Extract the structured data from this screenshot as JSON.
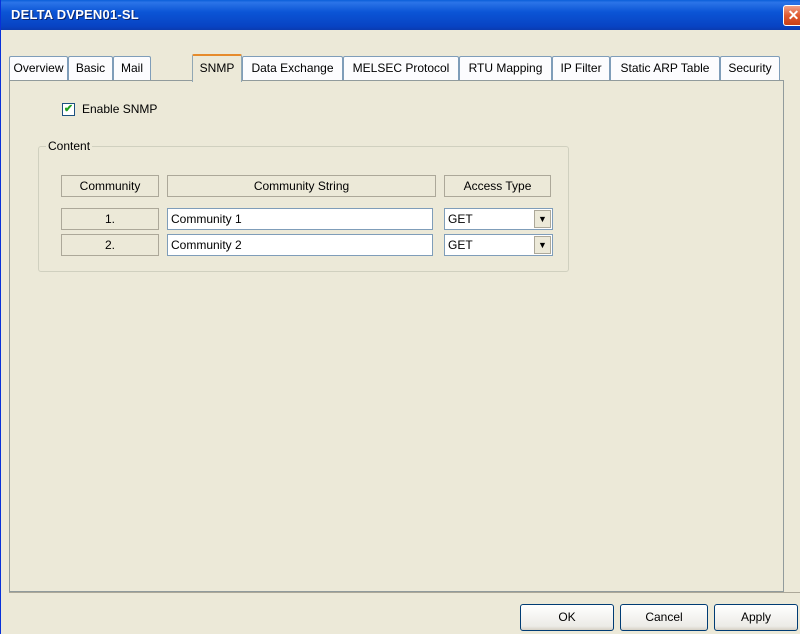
{
  "window": {
    "title": "DELTA DVPEN01-SL",
    "close_symbol": "✕"
  },
  "tabs": [
    {
      "label": "Overview"
    },
    {
      "label": "Basic"
    },
    {
      "label": "Mail"
    },
    {
      "label": "SNMP"
    },
    {
      "label": "Data Exchange"
    },
    {
      "label": "MELSEC Protocol"
    },
    {
      "label": "RTU Mapping"
    },
    {
      "label": "IP Filter"
    },
    {
      "label": "Static ARP Table"
    },
    {
      "label": "Security"
    }
  ],
  "active_tab": "SNMP",
  "snmp": {
    "enable_label": "Enable SNMP",
    "enable_checked": true,
    "check_mark": "✔",
    "content_group_label": "Content",
    "columns": {
      "community": "Community",
      "string": "Community String",
      "access": "Access Type"
    },
    "rows": [
      {
        "num": "1.",
        "string": "Community 1",
        "access": "GET"
      },
      {
        "num": "2.",
        "string": "Community 2",
        "access": "GET"
      }
    ],
    "dropdown_arrow": "▼"
  },
  "buttons": {
    "ok": "OK",
    "cancel": "Cancel",
    "apply": "Apply"
  }
}
